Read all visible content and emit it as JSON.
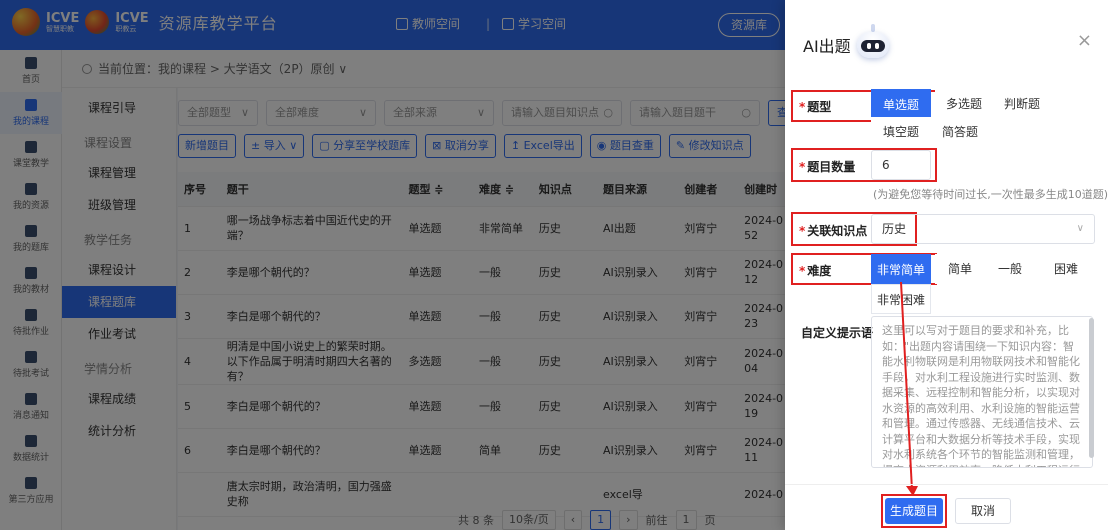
{
  "header": {
    "logo1": "ICVE",
    "logo1_sub": "智慧职教",
    "logo2": "ICVE",
    "logo2_sub": "职教云",
    "platform_title": "资源库教学平台",
    "tab_teacher": "教师空间",
    "tab_student": "学习空间",
    "repo_label": "资源库"
  },
  "leftnav": {
    "items": [
      {
        "label": "首页",
        "icon": "home-icon"
      },
      {
        "label": "我的课程",
        "icon": "course-icon",
        "active": true
      },
      {
        "label": "课堂教学",
        "icon": "classroom-icon"
      },
      {
        "label": "我的资源",
        "icon": "resource-icon"
      },
      {
        "label": "我的题库",
        "icon": "question-bank-icon"
      },
      {
        "label": "我的教材",
        "icon": "textbook-icon"
      },
      {
        "label": "待批作业",
        "icon": "homework-icon"
      },
      {
        "label": "待批考试",
        "icon": "exam-icon"
      },
      {
        "label": "消息通知",
        "icon": "message-icon"
      },
      {
        "label": "数据统计",
        "icon": "stats-icon"
      },
      {
        "label": "第三方应用",
        "icon": "apps-icon"
      }
    ]
  },
  "breadcrumb": "当前位置：我的课程 > 大学语文（2P）原创 ∨",
  "subnav": {
    "guide": "课程引导",
    "group1": "课程设置",
    "manage": "课程管理",
    "class": "班级管理",
    "group2": "教学任务",
    "design": "课程设计",
    "bank": "课程题库",
    "homework": "作业考试",
    "group3": "学情分析",
    "grades": "课程成绩",
    "stats": "统计分析"
  },
  "filters": {
    "type": "全部题型",
    "difficulty": "全部难度",
    "source": "全部来源",
    "kp_placeholder": "请输入题目知识点",
    "stem_placeholder": "请输入题目题干",
    "search": "查"
  },
  "toolbar": {
    "add": "新增题目",
    "import": "导入",
    "share": "分享至学校题库",
    "unshare": "取消分享",
    "excel": "Excel导出",
    "check": "题目查重",
    "edit_kp": "修改知识点"
  },
  "table": {
    "headers": [
      "序号",
      "题干",
      "题型 ≑",
      "难度 ≑",
      "知识点",
      "题目来源",
      "创建者",
      "创建时"
    ],
    "rows": [
      [
        "1",
        "哪一场战争标志着中国近代史的开端？",
        "单选题",
        "非常简单",
        "历史",
        "AI出题",
        "刘宵宁",
        "2024-0 52"
      ],
      [
        "2",
        "李是哪个朝代的？",
        "单选题",
        "一般",
        "历史",
        "AI识别录入",
        "刘宵宁",
        "2024-0 12"
      ],
      [
        "3",
        "李白是哪个朝代的？",
        "单选题",
        "一般",
        "历史",
        "AI识别录入",
        "刘宵宁",
        "2024-0 23"
      ],
      [
        "4",
        "明清是中国小说史上的繁荣时期。以下作品属于明清时期四大名著的有？",
        "多选题",
        "一般",
        "历史",
        "AI识别录入",
        "刘宵宁",
        "2024-0 04"
      ],
      [
        "5",
        "李白是哪个朝代的？",
        "单选题",
        "一般",
        "历史",
        "AI识别录入",
        "刘宵宁",
        "2024-0 19"
      ],
      [
        "6",
        "李白是哪个朝代的？",
        "单选题",
        "简单",
        "历史",
        "AI识别录入",
        "刘宵宁",
        "2024-0 11"
      ],
      [
        "",
        "唐太宗时期，政治清明，国力强盛史称",
        "",
        "",
        "",
        "excel导",
        "",
        "2024-0"
      ]
    ]
  },
  "pager": {
    "total": "共 8 条",
    "size": "10条/页",
    "page": "1",
    "goto": "前往",
    "goto_page": "1",
    "page_unit": "页"
  },
  "drawer": {
    "title": "AI出题",
    "close": "×",
    "type_label": "题型",
    "types": [
      "单选题",
      "多选题",
      "判断题",
      "填空题",
      "简答题"
    ],
    "type_selected": "单选题",
    "count_label": "题目数量",
    "count_value": "6",
    "count_hint": "(为避免您等待时间过长,一次性最多生成10道题)",
    "kp_label": "关联知识点",
    "kp_value": "历史",
    "diff_label": "难度",
    "diffs": [
      "非常简单",
      "简单",
      "一般",
      "困难",
      "非常困难"
    ],
    "diff_selected": "非常简单",
    "prompt_label": "自定义提示语",
    "prompt_placeholder": "这里可以写对于题目的要求和补充，比如：\"出题内容请围绕一下知识内容：智能水利物联网是利用物联网技术和智能化手段，对水利工程设施进行实时监测、数据采集、远程控制和智能分析，以实现对水资源的高效利用、水利设施的智能运营和管理。通过传感器、无线通信技术、云计算平台和大数据分析等技术手段，实现对水利系统各个环节的智能监测和管理，提高水资源利用效率、降低水利工程运行成本，保障水利工程安全",
    "generate": "生成题目",
    "cancel": "取消"
  },
  "colors": {
    "primary": "#2f6cf0",
    "highlight": "#e02020"
  }
}
